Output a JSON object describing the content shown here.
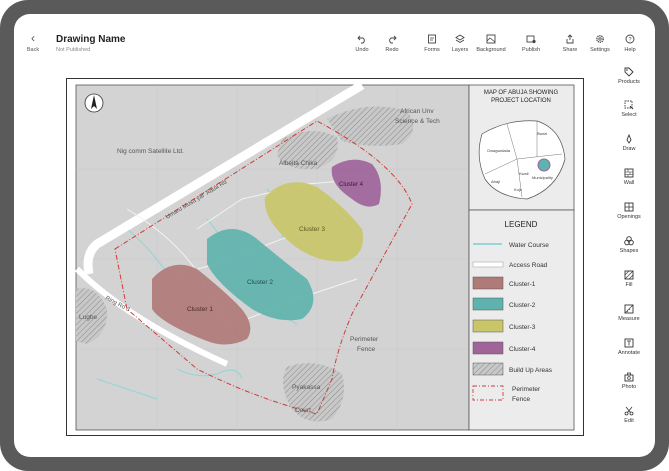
{
  "header": {
    "back_label": "Back",
    "title": "Drawing Name",
    "subtitle": "Not Published"
  },
  "toolbar": {
    "undo": "Undo",
    "redo": "Redo",
    "forms": "Forms",
    "layers": "Layers",
    "background": "Background",
    "publish": "Publish",
    "share": "Share",
    "settings": "Settings",
    "help": "Help"
  },
  "sidebar": {
    "products": "Products",
    "select": "Select",
    "draw": "Draw",
    "wall": "Wall",
    "openings": "Openings",
    "shapes": "Shapes",
    "fill": "Fill",
    "measure": "Measure",
    "annotate": "Annotate",
    "photo": "Photo",
    "edit": "Edit"
  },
  "map": {
    "labels": {
      "nig_comm": "Nig comm Satellite Ltd.",
      "african_univ_1": "African Unv",
      "african_univ_2": "Science & Tech",
      "albeita": "Albeita Chika",
      "road": "Umaru Musa yar' Adua Rd",
      "ring_rd": "Ring Rd 3",
      "lugbe": "Lugbe",
      "pyakassa": "Pyakassa",
      "court": "Court",
      "perimeter_1": "Perimeter",
      "perimeter_2": "Fence",
      "cluster1": "Cluster 1",
      "cluster2": "Cluster 2",
      "cluster3": "Cluster 3",
      "cluster4": "Cluster 4",
      "north": "N"
    },
    "inset": {
      "title_1": "MAP OF ABUJA SHOWING",
      "title_2": "PROJECT LOCATION",
      "areas": [
        "Bwari",
        "Gwagwalada",
        "Abaji",
        "Kuje",
        "Kwali",
        "Municipality"
      ]
    },
    "legend": {
      "title": "LEGEND",
      "items": [
        {
          "label": "Water Course",
          "color": "#9ad4d6"
        },
        {
          "label": "Access Road",
          "color": "#ffffff"
        },
        {
          "label": "Cluster-1",
          "color": "#b07a78"
        },
        {
          "label": "Cluster-2",
          "color": "#5fb3ae"
        },
        {
          "label": "Cluster-3",
          "color": "#c9c66a"
        },
        {
          "label": "Cluster-4",
          "color": "#a0649a"
        },
        {
          "label": "Build Up Areas",
          "color": "#bdbdbd"
        },
        {
          "label": "Perimeter",
          "color": "#d03a3a"
        },
        {
          "label": "Fence",
          "color": "#d03a3a"
        }
      ]
    }
  }
}
